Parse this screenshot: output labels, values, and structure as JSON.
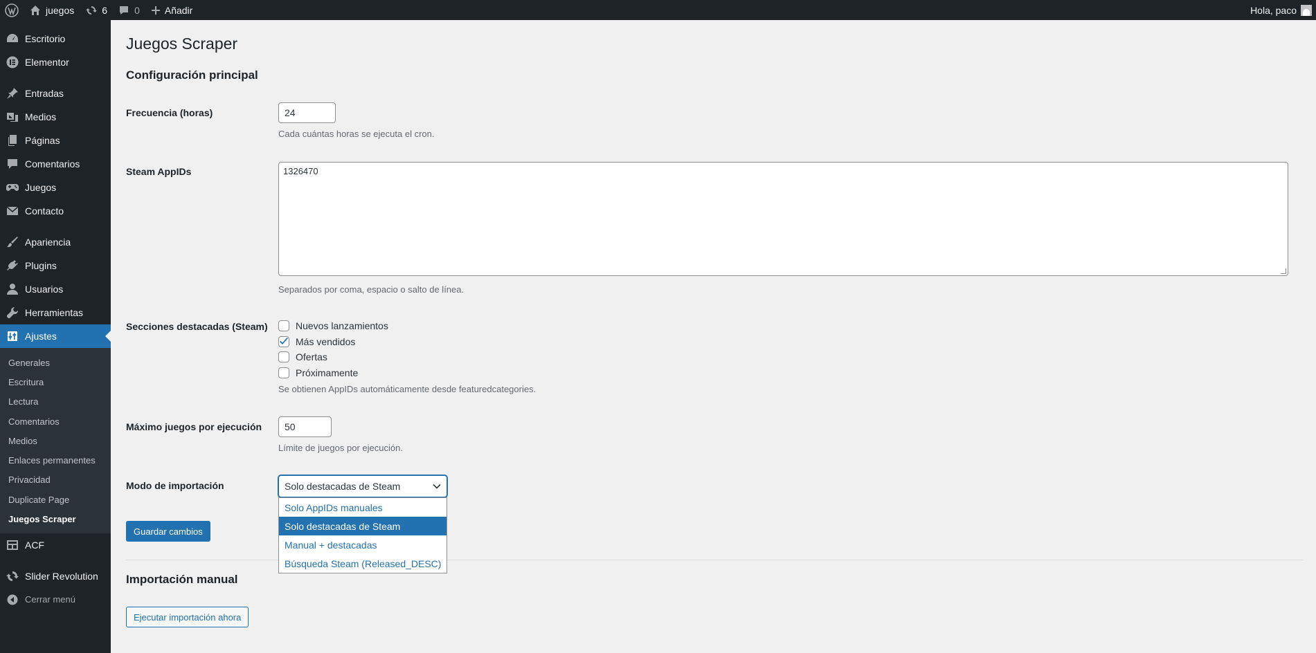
{
  "adminbar": {
    "site_name": "juegos",
    "updates_count": "6",
    "comments_count": "0",
    "new_label": "Añadir",
    "greeting": "Hola, paco"
  },
  "sidebar": {
    "items": [
      {
        "label": "Escritorio",
        "icon": "dashboard-icon"
      },
      {
        "label": "Elementor",
        "icon": "elementor-icon"
      },
      {
        "label": "Entradas",
        "icon": "pin-icon"
      },
      {
        "label": "Medios",
        "icon": "media-icon"
      },
      {
        "label": "Páginas",
        "icon": "page-icon"
      },
      {
        "label": "Comentarios",
        "icon": "comment-icon"
      },
      {
        "label": "Juegos",
        "icon": "gamepad-icon"
      },
      {
        "label": "Contacto",
        "icon": "envelope-icon"
      },
      {
        "label": "Apariencia",
        "icon": "brush-icon"
      },
      {
        "label": "Plugins",
        "icon": "plugin-icon"
      },
      {
        "label": "Usuarios",
        "icon": "user-icon"
      },
      {
        "label": "Herramientas",
        "icon": "wrench-icon"
      },
      {
        "label": "Ajustes",
        "icon": "settings-icon"
      }
    ],
    "submenu": [
      "Generales",
      "Escritura",
      "Lectura",
      "Comentarios",
      "Medios",
      "Enlaces permanentes",
      "Privacidad",
      "Duplicate Page",
      "Juegos Scraper"
    ],
    "after_items": [
      {
        "label": "ACF",
        "icon": "acf-icon"
      },
      {
        "label": "Slider Revolution",
        "icon": "refresh-icon"
      }
    ],
    "collapse_label": "Cerrar menú"
  },
  "page": {
    "title": "Juegos Scraper",
    "section_main": "Configuración principal",
    "frequency": {
      "label": "Frecuencia (horas)",
      "value": "24",
      "description": "Cada cuántas horas se ejecuta el cron."
    },
    "appids": {
      "label": "Steam AppIDs",
      "value": "1326470",
      "description": "Separados por coma, espacio o salto de línea."
    },
    "sections": {
      "label": "Secciones destacadas (Steam)",
      "options": [
        {
          "label": "Nuevos lanzamientos",
          "checked": false
        },
        {
          "label": "Más vendidos",
          "checked": true
        },
        {
          "label": "Ofertas",
          "checked": false
        },
        {
          "label": "Próximamente",
          "checked": false
        }
      ],
      "description": "Se obtienen AppIDs automáticamente desde featuredcategories."
    },
    "max_games": {
      "label": "Máximo juegos por ejecución",
      "value": "50",
      "description": "Límite de juegos por ejecución."
    },
    "import_mode": {
      "label": "Modo de importación",
      "selected": "Solo destacadas de Steam",
      "options": [
        "Solo AppIDs manuales",
        "Solo destacadas de Steam",
        "Manual + destacadas",
        "Búsqueda Steam (Released_DESC)"
      ]
    },
    "save_button": "Guardar cambios",
    "section_manual": "Importación manual",
    "run_button": "Ejecutar importación ahora"
  },
  "colors": {
    "accent": "#2271b1",
    "sidebar_bg": "#1d2327",
    "content_bg": "#f0f0f1"
  }
}
